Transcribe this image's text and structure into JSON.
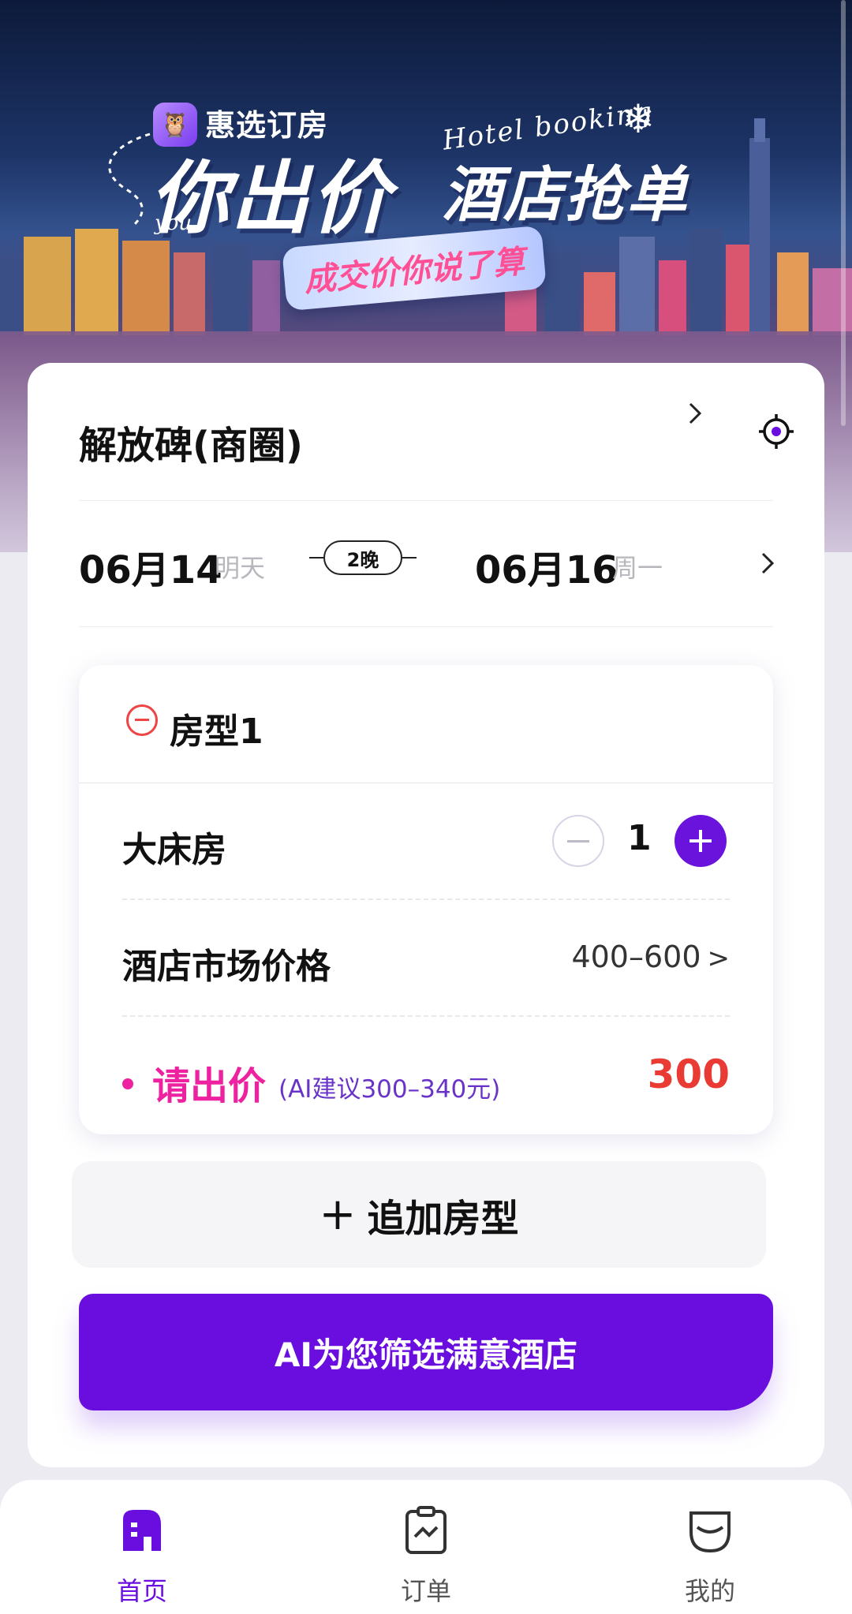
{
  "banner": {
    "app_name": "惠选订房",
    "tagline_en": "Hotel booking",
    "headline_left": "你出价",
    "headline_right": "酒店抢单",
    "you_label": "you",
    "ribbon_text": "成交价你说了算"
  },
  "search": {
    "location": "解放碑(商圈)",
    "checkin_date": "06月14",
    "checkin_day": "明天",
    "nights": "2晚",
    "checkout_date": "06月16",
    "checkout_day": "周一"
  },
  "room": {
    "title": "房型1",
    "bed_type": "大床房",
    "quantity": "1",
    "market_price_label": "酒店市场价格",
    "market_price_range": "400–600",
    "market_price_arrow": ">",
    "bid_label": "请出价",
    "bid_hint": "(AI建议300–340元)",
    "bid_value": "300"
  },
  "actions": {
    "add_room_plus": "+",
    "add_room_label": "追加房型",
    "ai_button_label": "AI为您筛选满意酒店"
  },
  "tabbar": {
    "items": [
      {
        "label": "首页",
        "icon": "home-icon",
        "active": true
      },
      {
        "label": "订单",
        "icon": "order-icon",
        "active": false
      },
      {
        "label": "我的",
        "icon": "profile-icon",
        "active": false
      }
    ]
  },
  "colors": {
    "accent": "#6a0ee0",
    "bid_pink": "#ee22a0",
    "price_red": "#e93a33",
    "remove_red": "#ee4444"
  }
}
